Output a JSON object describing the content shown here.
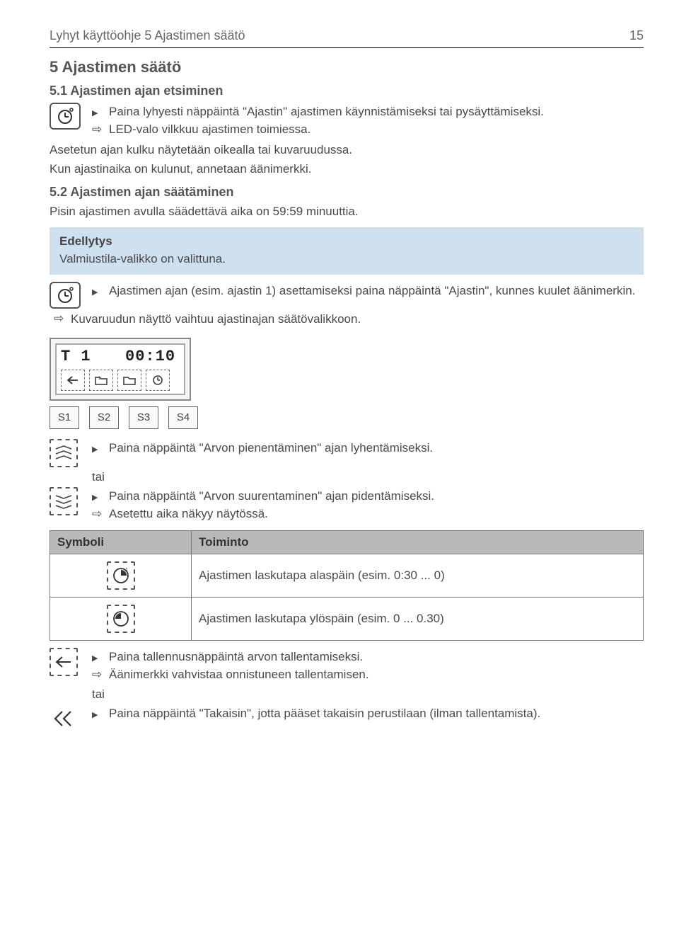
{
  "header": {
    "left": "Lyhyt käyttöohje 5 Ajastimen säätö",
    "right": "15"
  },
  "h2": "5 Ajastimen säätö",
  "h3a": "5.1 Ajastimen ajan etsiminen",
  "s51": {
    "b1": "Paina lyhyesti näppäintä \"Ajastin\" ajastimen käynnistämiseksi tai pysäyttämiseksi.",
    "r1": "LED-valo vilkkuu ajastimen toimiessa.",
    "p1": "Asetetun ajan kulku näytetään oikealla tai kuvaruudussa.",
    "p2": "Kun ajastinaika on kulunut, annetaan äänimerkki."
  },
  "h3b": "5.2 Ajastimen ajan säätäminen",
  "s52": {
    "intro": "Pisin ajastimen avulla säädettävä aika on 59:59 minuuttia.",
    "boxTitle": "Edellytys",
    "boxText": "Valmiustila-valikko on valittuna.",
    "b1": "Ajastimen ajan (esim. ajastin 1) asettamiseksi paina näppäintä \"Ajastin\", kunnes kuulet äänimerkin.",
    "r1": "Kuvaruudun näyttö vaihtuu ajastinajan säätövalikkoon."
  },
  "lcd": {
    "left": "T 1",
    "right": "00:10",
    "icons": [
      "back-arrow-icon",
      "folder-down-icon",
      "folder-icon",
      "clock-small-icon"
    ]
  },
  "sbuttons": [
    "S1",
    "S2",
    "S3",
    "S4"
  ],
  "s52b": {
    "b1": "Paina näppäintä \"Arvon pienentäminen\" ajan lyhentämiseksi.",
    "tai": "tai",
    "b2": "Paina näppäintä \"Arvon suurentaminen\" ajan pidentämiseksi.",
    "r2": "Asetettu aika näkyy näytössä."
  },
  "table": {
    "h1": "Symboli",
    "h2": "Toiminto",
    "row1": "Ajastimen laskutapa alaspäin (esim. 0:30 ... 0)",
    "row2": "Ajastimen laskutapa ylöspäin (esim. 0 ... 0.30)"
  },
  "s52c": {
    "b1": "Paina tallennusnäppäintä arvon tallentamiseksi.",
    "r1": "Äänimerkki vahvistaa onnistuneen tallentamisen.",
    "tai": "tai",
    "b2": "Paina näppäintä \"Takaisin\", jotta pääset takaisin perustilaan (ilman tallentamista)."
  },
  "iconNames": {
    "timer": "timer-icon",
    "decrease": "decrease-value-icon",
    "increase": "increase-value-icon",
    "countDown": "count-down-icon",
    "countUp": "count-up-icon",
    "save": "save-back-icon",
    "back": "back-double-icon"
  }
}
